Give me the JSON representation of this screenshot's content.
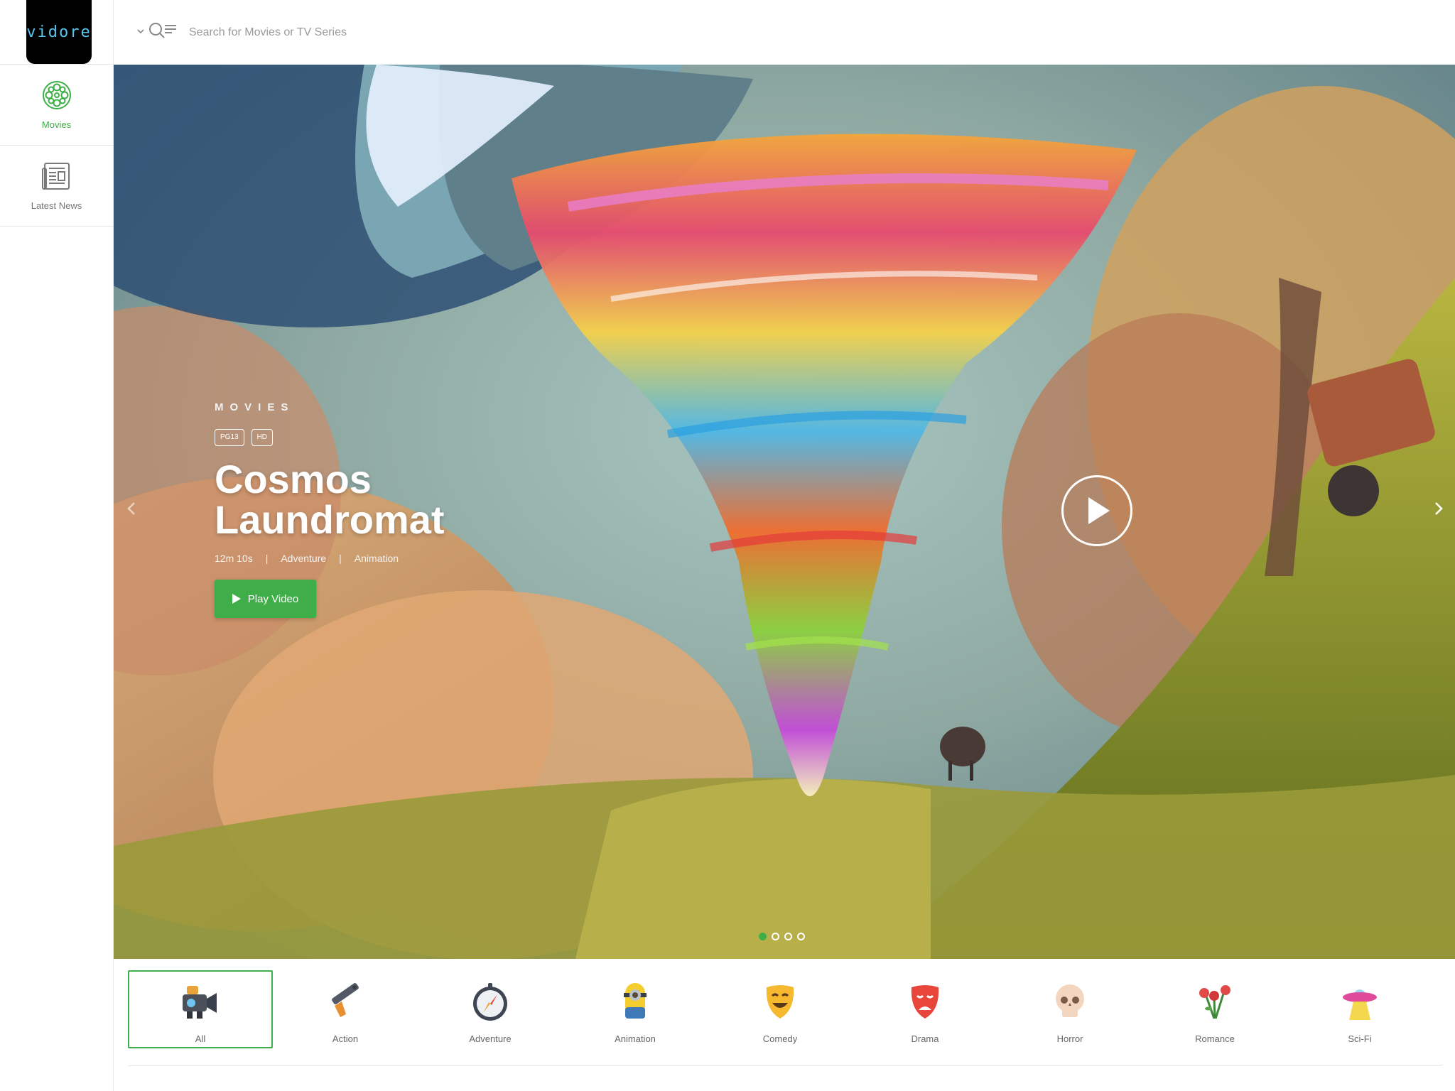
{
  "app": {
    "logo_text": "vidore",
    "accent": "#3fae49"
  },
  "sidebar": {
    "items": [
      {
        "label": "Movies",
        "icon": "film-reel-icon",
        "active": true
      },
      {
        "label": "Latest News",
        "icon": "newspaper-icon",
        "active": false
      }
    ]
  },
  "search": {
    "placeholder": "Search for Movies or TV Series",
    "icons": [
      "chevron-down-icon",
      "search-filter-icon"
    ]
  },
  "hero": {
    "category": "MOVIES",
    "badges": [
      "PG13",
      "HD"
    ],
    "title": "Cosmos Laundromat",
    "meta": {
      "duration": "12m 10s",
      "genres": [
        "Adventure",
        "Animation"
      ],
      "separator": "|"
    },
    "play_label": "Play Video",
    "slides": {
      "count": 4,
      "active": 1
    }
  },
  "genres": [
    {
      "label": "All",
      "icon": "video-camera-icon",
      "active": true
    },
    {
      "label": "Action",
      "icon": "gun-icon",
      "active": false
    },
    {
      "label": "Adventure",
      "icon": "compass-icon",
      "active": false
    },
    {
      "label": "Animation",
      "icon": "minion-icon",
      "active": false
    },
    {
      "label": "Comedy",
      "icon": "comedy-mask-icon",
      "active": false
    },
    {
      "label": "Drama",
      "icon": "drama-mask-icon",
      "active": false
    },
    {
      "label": "Horror",
      "icon": "skull-icon",
      "active": false
    },
    {
      "label": "Romance",
      "icon": "roses-icon",
      "active": false
    },
    {
      "label": "Sci-Fi",
      "icon": "ufo-icon",
      "active": false
    }
  ]
}
